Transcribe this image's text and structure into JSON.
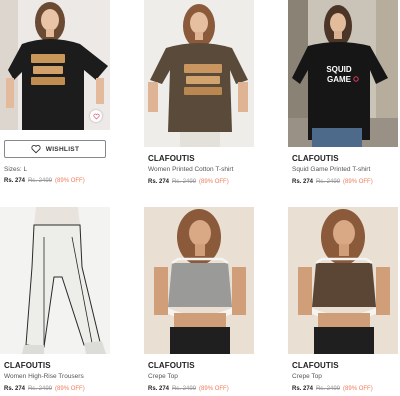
{
  "products": [
    {
      "brand": "",
      "name": "",
      "price": "",
      "mrp": "",
      "discount": "",
      "sizes": "Sizes: L",
      "wishlist_label": "WISHLIST"
    },
    {
      "brand": "CLAFOUTIS",
      "name": "Women Printed Cotton T-shirt",
      "price": "Rs. 274",
      "mrp": "Rs. 2499",
      "discount": "(89% OFF)"
    },
    {
      "brand": "CLAFOUTIS",
      "name": "Squid Game Printed T-shirt",
      "price": "Rs. 274",
      "mrp": "Rs. 2499",
      "discount": "(89% OFF)",
      "print_text_1": "SQUID",
      "print_text_2": "GAME"
    },
    {
      "brand": "CLAFOUTIS",
      "name": "Women High-Rise Trousers",
      "price": "Rs. 274",
      "mrp": "Rs. 2499",
      "discount": "(89% OFF)"
    },
    {
      "brand": "CLAFOUTIS",
      "name": "Crepe Top",
      "price": "Rs. 274",
      "mrp": "Rs. 2499",
      "discount": "(89% OFF)"
    },
    {
      "brand": "CLAFOUTIS",
      "name": "Crepe Top",
      "price": "Rs. 274",
      "mrp": "Rs. 2499",
      "discount": "(89% OFF)"
    }
  ],
  "colors": {
    "discount": "#f07b5a",
    "tee_black": "#1c1c1c",
    "tee_brown": "#5a4a3a",
    "background_beige": "#e9dfd2"
  },
  "icons": [
    "heart-icon",
    "heart-outline-icon"
  ]
}
